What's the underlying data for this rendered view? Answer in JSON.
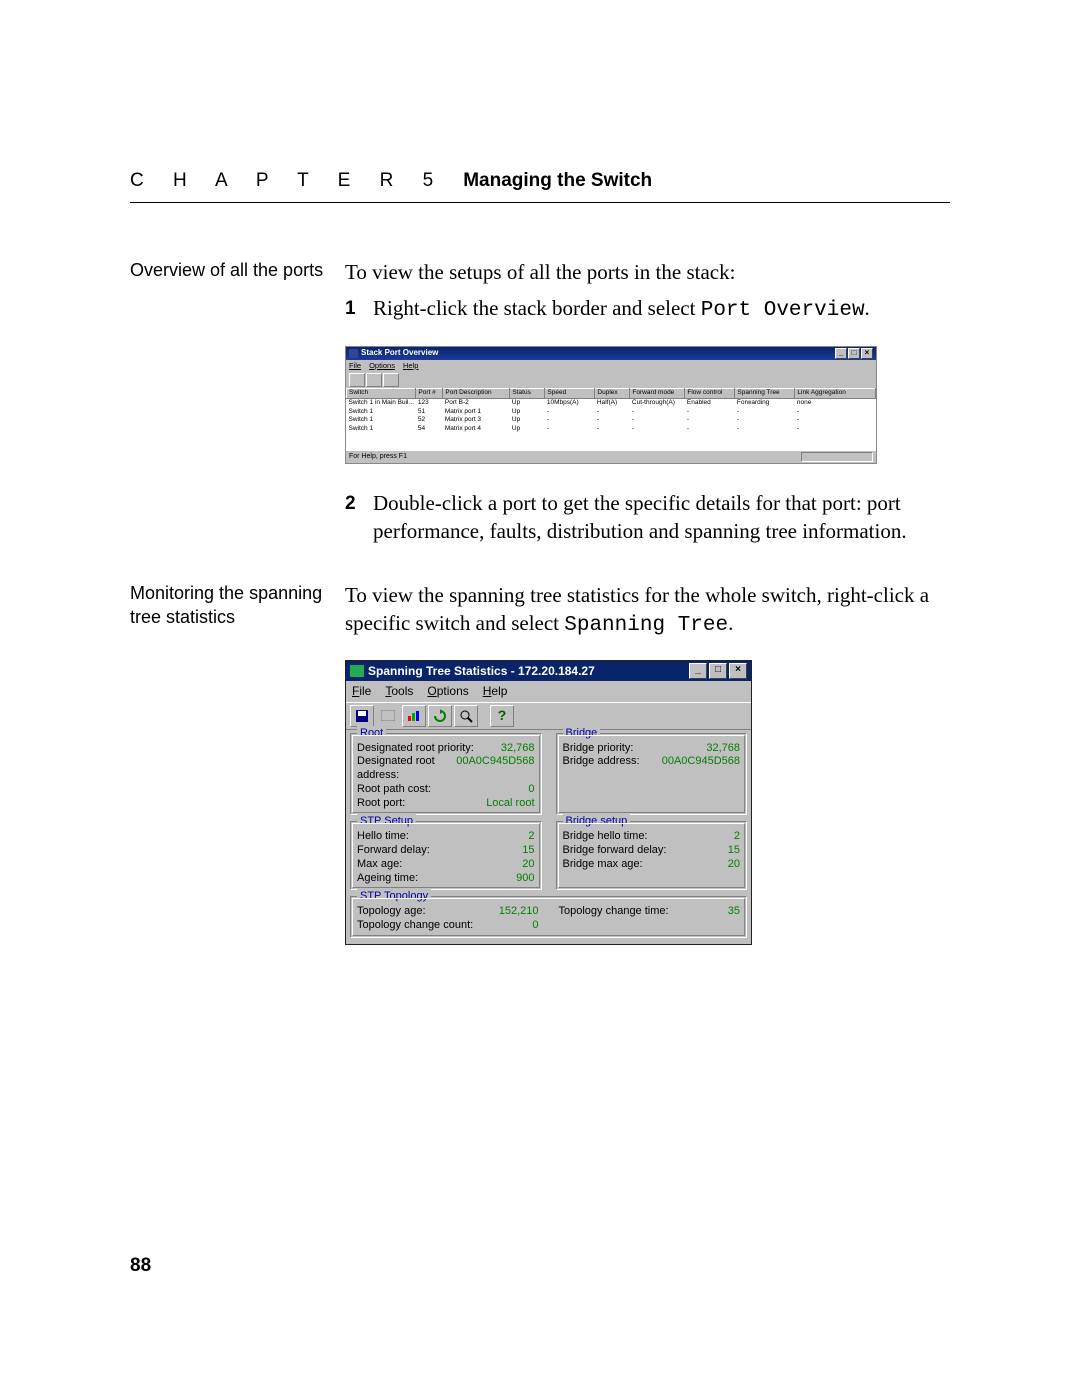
{
  "header": {
    "chapter": "C H A P T E R  5",
    "title": "Managing the Switch"
  },
  "section1": {
    "margin": "Overview of all the ports",
    "intro": "To view the setups of all the ports in the stack:",
    "step1_label": "1",
    "step1_text": "Right-click the stack border and select ",
    "step1_mono": "Port Overview",
    "step1_tail": ".",
    "step2_label": "2",
    "step2_text": "Double-click a port to get the specific details for that port: port performance, faults, distribution and spanning tree information."
  },
  "section2": {
    "margin": "Monitoring the spanning tree statistics",
    "text_a": "To view the spanning tree statistics for the whole switch, right-click a specific switch and select ",
    "text_mono": "Spanning Tree",
    "text_tail": "."
  },
  "shot1": {
    "title": "Stack Port Overview",
    "menus": [
      "File",
      "Options",
      "Help"
    ],
    "headers": [
      "Switch",
      "Port #",
      "Port Description",
      "Status",
      "Speed",
      "Duplex",
      "Forward mode",
      "Flow control",
      "Spanning Tree",
      "Link Aggregation"
    ],
    "rows": [
      [
        "Switch 1 in Main Buil...",
        "123",
        "Port B-2",
        "Up",
        "10Mbps(A)",
        "Half(A)",
        "Cut-through(A)",
        "Enabled",
        "Forwarding",
        "none"
      ],
      [
        "Switch 1",
        "51",
        "Matrix port 1",
        "Up",
        "-",
        "-",
        "-",
        "-",
        "-",
        "-"
      ],
      [
        "Switch 1",
        "52",
        "Matrix port 3",
        "Up",
        "-",
        "-",
        "-",
        "-",
        "-",
        "-"
      ],
      [
        "Switch 1",
        "54",
        "Matrix port 4",
        "Up",
        "-",
        "-",
        "-",
        "-",
        "-",
        "-"
      ]
    ],
    "status": "For Help, press F1"
  },
  "shot2": {
    "title": "Spanning Tree Statistics - 172.20.184.27",
    "menus": [
      "File",
      "Tools",
      "Options",
      "Help"
    ],
    "root": {
      "legend": "Root",
      "items": [
        [
          "Designated root priority:",
          "32,768"
        ],
        [
          "Designated root address:",
          "00A0C945D568"
        ],
        [
          "Root path cost:",
          "0"
        ],
        [
          "Root port:",
          "Local root"
        ]
      ]
    },
    "bridge": {
      "legend": "Bridge",
      "items": [
        [
          "Bridge priority:",
          "32,768"
        ],
        [
          "Bridge address:",
          "00A0C945D568"
        ]
      ]
    },
    "stp_setup": {
      "legend": "STP Setup",
      "items": [
        [
          "Hello time:",
          "2"
        ],
        [
          "Forward delay:",
          "15"
        ],
        [
          "Max age:",
          "20"
        ],
        [
          "Ageing time:",
          "900"
        ]
      ]
    },
    "bridge_setup": {
      "legend": "Bridge setup",
      "items": [
        [
          "Bridge hello time:",
          "2"
        ],
        [
          "Bridge forward delay:",
          "15"
        ],
        [
          "Bridge max age:",
          "20"
        ]
      ]
    },
    "stp_topology": {
      "legend": "STP Topology",
      "left": [
        [
          "Topology age:",
          "152,210"
        ],
        [
          "Topology change count:",
          "0"
        ]
      ],
      "right": [
        [
          "Topology change time:",
          "35"
        ]
      ]
    }
  },
  "page_number": "88"
}
